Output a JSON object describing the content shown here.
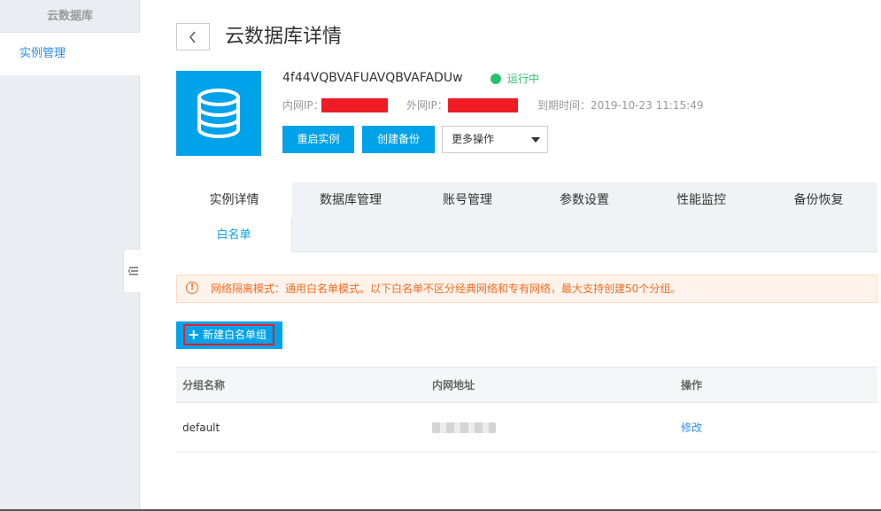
{
  "sidebar": {
    "title": "云数据库",
    "items": [
      {
        "label": "实例管理"
      }
    ]
  },
  "header": {
    "title": "云数据库详情"
  },
  "instance": {
    "id": "4f44VQBVAFUAVQBVAFADUw",
    "status": "运行中",
    "private_ip_label": "内网IP：",
    "public_ip_label": "外网IP：",
    "expire_label": "到期时间：",
    "expire_value": "2019-10-23 11:15:49",
    "status_color": "#2bc26f"
  },
  "actions": {
    "restart": "重启实例",
    "backup": "创建备份",
    "more": "更多操作"
  },
  "tabs": [
    {
      "label": "实例详情"
    },
    {
      "label": "数据库管理"
    },
    {
      "label": "账号管理"
    },
    {
      "label": "参数设置"
    },
    {
      "label": "性能监控"
    },
    {
      "label": "备份恢复"
    }
  ],
  "subtabs": [
    {
      "label": "白名单"
    }
  ],
  "alert": {
    "text": "网络隔离模式：通用白名单模式。以下白名单不区分经典网络和专有网络，最大支持创建50个分组。"
  },
  "whitelist": {
    "new_group": "新建白名单组",
    "columns": [
      "分组名称",
      "内网地址",
      "操作"
    ],
    "rows": [
      {
        "name": "default",
        "action": "修改"
      }
    ]
  },
  "colors": {
    "accent": "#00a2ea",
    "warning": "#f56c22"
  }
}
